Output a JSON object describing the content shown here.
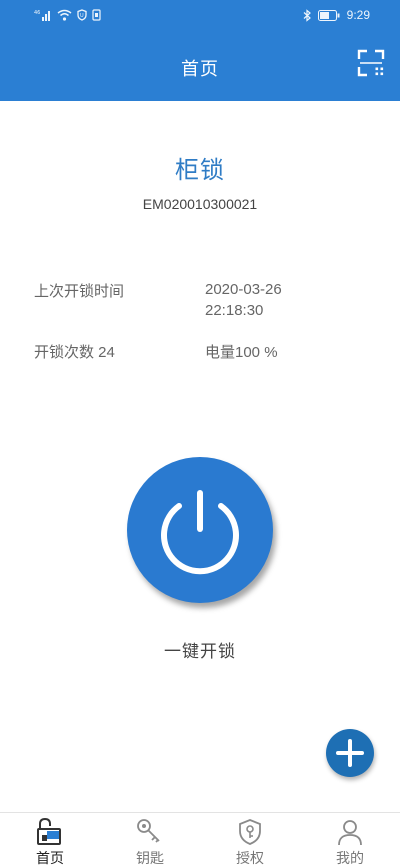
{
  "status_bar": {
    "time": "9:29",
    "icons": [
      "signal-icon",
      "wifi-icon",
      "shield-icon",
      "sim-icon",
      "bluetooth-icon",
      "battery-icon"
    ]
  },
  "header": {
    "title": "首页",
    "scan_icon": "scan-icon"
  },
  "device": {
    "name": "柜锁",
    "id": "EM020010300021"
  },
  "info": {
    "last_unlock_label": "上次开锁时间",
    "last_unlock_date": "2020-03-26",
    "last_unlock_time": "22:18:30",
    "unlock_count_text": "开锁次数 24",
    "battery_text": "电量100 %"
  },
  "power": {
    "icon": "power-icon",
    "label": "一键开锁"
  },
  "fab": {
    "icon": "plus-icon"
  },
  "bottom_nav": {
    "items": [
      {
        "label": "首页",
        "icon": "home-lock-icon",
        "active": true
      },
      {
        "label": "钥匙",
        "icon": "key-icon",
        "active": false
      },
      {
        "label": "授权",
        "icon": "shield-key-icon",
        "active": false
      },
      {
        "label": "我的",
        "icon": "user-icon",
        "active": false
      }
    ]
  },
  "colors": {
    "primary": "#2b7fd3",
    "power_button": "#2a7ad0",
    "fab": "#1e6fb4",
    "title_text": "#2f7cc5"
  }
}
